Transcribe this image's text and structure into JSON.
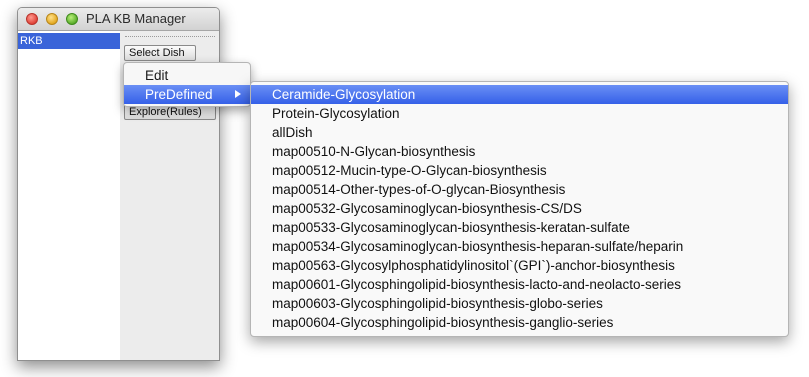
{
  "window": {
    "title": "PLA KB Manager",
    "tree_items": [
      "RKB"
    ],
    "buttons": {
      "select_dish": "Select Dish",
      "explore_rules": "Explore(Rules)"
    }
  },
  "context_menu": {
    "items": [
      "Edit",
      "PreDefined"
    ],
    "highlighted": "PreDefined"
  },
  "submenu": {
    "items": [
      "Ceramide-Glycosylation",
      "Protein-Glycosylation",
      "allDish",
      "map00510-N-Glycan-biosynthesis",
      "map00512-Mucin-type-O-Glycan-biosynthesis",
      "map00514-Other-types-of-O-glycan-Biosynthesis",
      "map00532-Glycosaminoglycan-biosynthesis-CS/DS",
      "map00533-Glycosaminoglycan-biosynthesis-keratan-sulfate",
      "map00534-Glycosaminoglycan-biosynthesis-heparan-sulfate/heparin",
      "map00563-Glycosylphosphatidylinositol`(GPI`)-anchor-biosynthesis",
      "map00601-Glycosphingolipid-biosynthesis-lacto-and-neolacto-series",
      "map00603-Glycosphingolipid-biosynthesis-globo-series",
      "map00604-Glycosphingolipid-biosynthesis-ganglio-series"
    ],
    "highlighted": "Ceramide-Glycosylation"
  },
  "colors": {
    "selection": "#3a64d9",
    "menu_highlight": "#3560e8",
    "window_bg": "#ececec"
  }
}
